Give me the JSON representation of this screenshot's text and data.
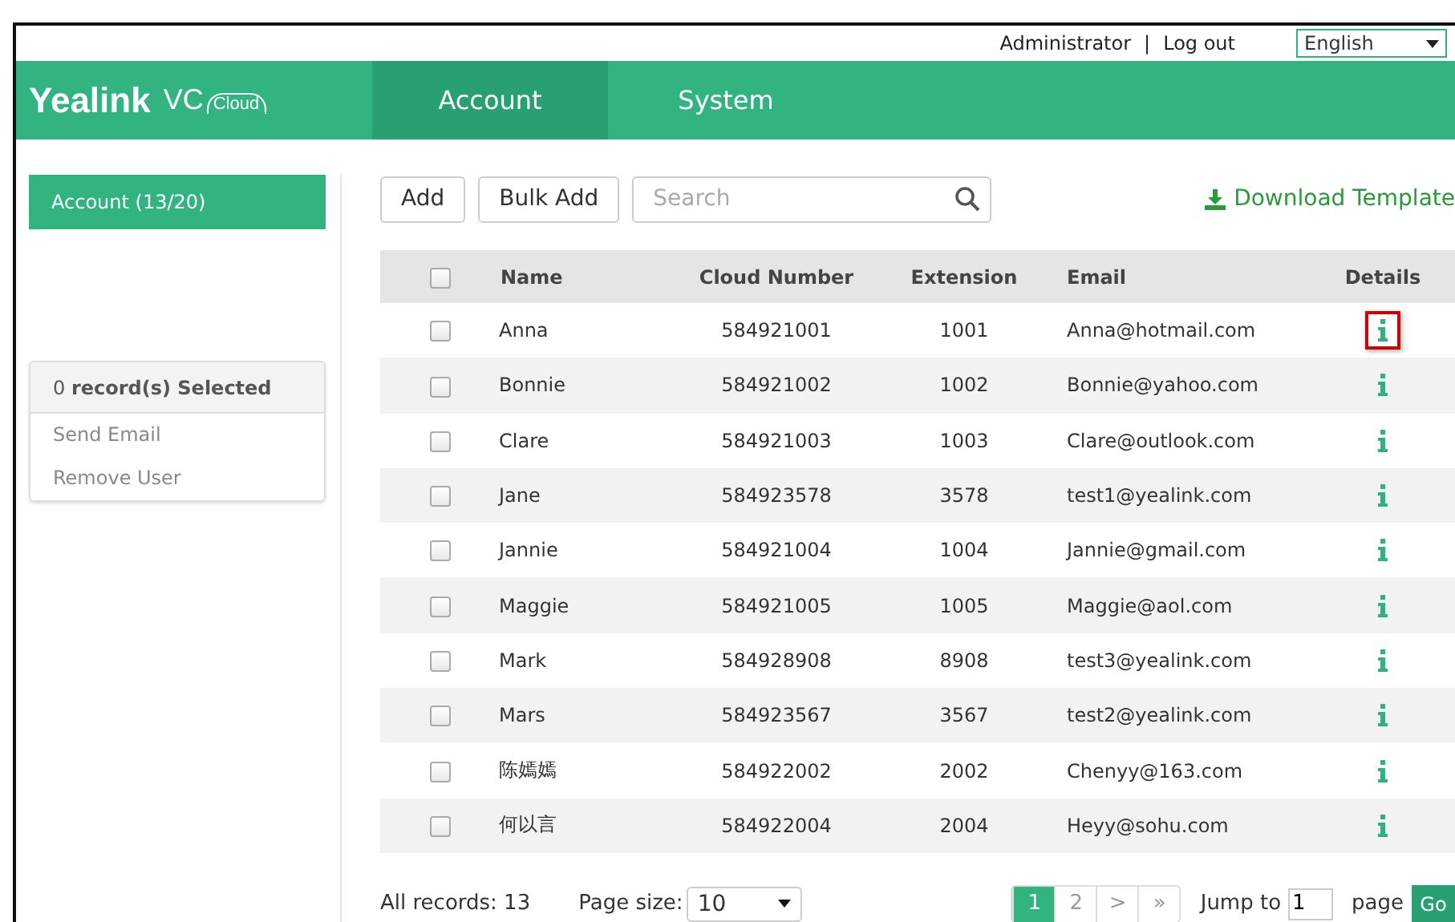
{
  "topbar": {
    "user": "Administrator",
    "separator": "|",
    "logout": "Log out",
    "language": "English"
  },
  "logo": {
    "brand": "Yealink",
    "product": "VC",
    "sub": "Cloud"
  },
  "nav": [
    {
      "label": "Account",
      "selected": true
    },
    {
      "label": "System",
      "selected": false
    }
  ],
  "sidebar": {
    "items": [
      {
        "label": "Account (13/20)",
        "selected": true
      }
    ],
    "selection": {
      "count": "0",
      "label": "record(s) Selected",
      "actions": [
        "Send Email",
        "Remove User"
      ]
    }
  },
  "toolbar": {
    "buttons": [
      "Add",
      "Bulk Add"
    ],
    "search": {
      "placeholder": "Search"
    },
    "download": "Download Template"
  },
  "table": {
    "columns": [
      "Name",
      "Cloud Number",
      "Extension",
      "Email",
      "Details"
    ],
    "header_checked": false,
    "rows": [
      {
        "checked": false,
        "name": "Anna",
        "number": "584921001",
        "extension": "1001",
        "email": "Anna@hotmail.com",
        "highlighted": true
      },
      {
        "checked": false,
        "name": "Bonnie",
        "number": "584921002",
        "extension": "1002",
        "email": "Bonnie@yahoo.com",
        "highlighted": false
      },
      {
        "checked": false,
        "name": "Clare",
        "number": "584921003",
        "extension": "1003",
        "email": "Clare@outlook.com",
        "highlighted": false
      },
      {
        "checked": false,
        "name": "Jane",
        "number": "584923578",
        "extension": "3578",
        "email": "test1@yealink.com",
        "highlighted": false
      },
      {
        "checked": false,
        "name": "Jannie",
        "number": "584921004",
        "extension": "1004",
        "email": "Jannie@gmail.com",
        "highlighted": false
      },
      {
        "checked": false,
        "name": "Maggie",
        "number": "584921005",
        "extension": "1005",
        "email": "Maggie@aol.com",
        "highlighted": false
      },
      {
        "checked": false,
        "name": "Mark",
        "number": "584928908",
        "extension": "8908",
        "email": "test3@yealink.com",
        "highlighted": false
      },
      {
        "checked": false,
        "name": "Mars",
        "number": "584923567",
        "extension": "3567",
        "email": "test2@yealink.com",
        "highlighted": false
      },
      {
        "checked": false,
        "name": "陈嫣嫣",
        "number": "584922002",
        "extension": "2002",
        "email": "Chenyy@163.com",
        "highlighted": false
      },
      {
        "checked": false,
        "name": "何以言",
        "number": "584922004",
        "extension": "2004",
        "email": "Heyy@sohu.com",
        "highlighted": false
      }
    ]
  },
  "footer": {
    "records": "All records: 13",
    "page_size_label": "Page size:",
    "page_size": "10",
    "pages": [
      {
        "label": "1",
        "selected": true
      },
      {
        "label": "2",
        "selected": false
      },
      {
        "label": ">",
        "selected": false
      },
      {
        "label": "»",
        "selected": false
      }
    ],
    "jump_label": "Jump to",
    "jump_value": "1",
    "page_label": "page",
    "go": "Go"
  }
}
